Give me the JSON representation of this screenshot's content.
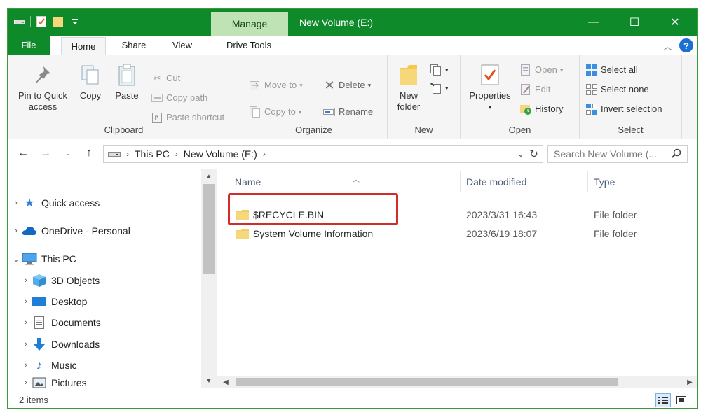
{
  "window": {
    "title": "New Volume (E:)",
    "context_tab": "Manage",
    "controls": {
      "minimize": "—",
      "maximize": "☐",
      "close": "✕"
    }
  },
  "tabs": [
    {
      "label": "File"
    },
    {
      "label": "Home"
    },
    {
      "label": "Share"
    },
    {
      "label": "View"
    },
    {
      "label": "Drive Tools"
    }
  ],
  "ribbon": {
    "clipboard": {
      "label": "Clipboard",
      "pin": "Pin to Quick access",
      "copy": "Copy",
      "paste": "Paste",
      "cut": "Cut",
      "copy_path": "Copy path",
      "paste_shortcut": "Paste shortcut"
    },
    "organize": {
      "label": "Organize",
      "move_to": "Move to",
      "copy_to": "Copy to",
      "delete": "Delete",
      "rename": "Rename"
    },
    "new": {
      "label": "New",
      "new_folder": "New folder"
    },
    "open": {
      "label": "Open",
      "properties": "Properties",
      "open": "Open",
      "edit": "Edit",
      "history": "History"
    },
    "select": {
      "label": "Select",
      "select_all": "Select all",
      "select_none": "Select none",
      "invert": "Invert selection"
    }
  },
  "address": {
    "crumbs": [
      "This PC",
      "New Volume (E:)"
    ],
    "search_placeholder": "Search New Volume (..."
  },
  "nav_pane": {
    "items": [
      {
        "label": "Quick access"
      },
      {
        "label": "OneDrive - Personal"
      },
      {
        "label": "This PC"
      },
      {
        "label": "3D Objects"
      },
      {
        "label": "Desktop"
      },
      {
        "label": "Documents"
      },
      {
        "label": "Downloads"
      },
      {
        "label": "Music"
      },
      {
        "label": "Pictures"
      }
    ]
  },
  "file_list": {
    "columns": {
      "name": "Name",
      "date": "Date modified",
      "type": "Type"
    },
    "rows": [
      {
        "name": "$RECYCLE.BIN",
        "date": "2023/3/31 16:43",
        "type": "File folder"
      },
      {
        "name": "System Volume Information",
        "date": "2023/6/19 18:07",
        "type": "File folder"
      }
    ]
  },
  "status": {
    "count": "2 items"
  },
  "colors": {
    "title_bar": "#0f8a2a",
    "manage_tab": "#bfe3b4",
    "highlight": "#d32a2a",
    "folder": "#f6d77a"
  }
}
